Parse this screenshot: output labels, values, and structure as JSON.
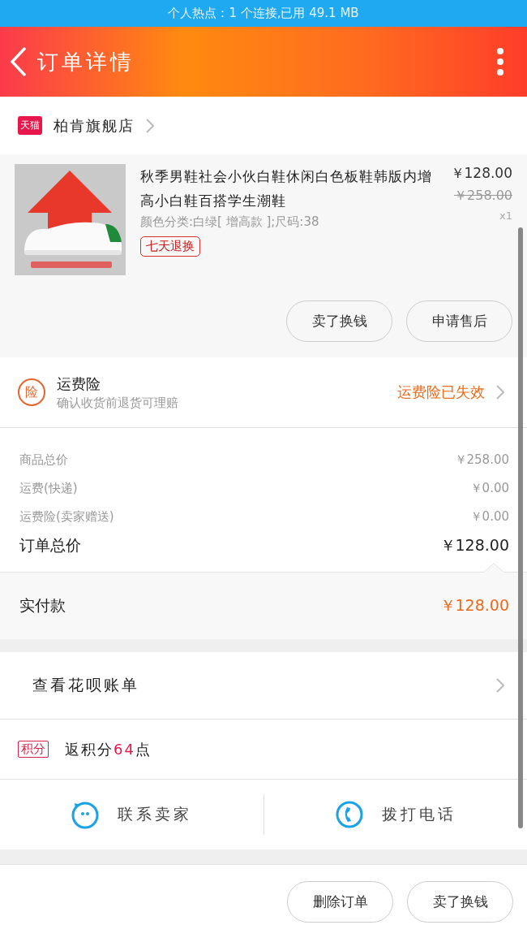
{
  "status_bar": {
    "text": "个人热点：1 个连接,已用 49.1 MB"
  },
  "header": {
    "title": "订单详情"
  },
  "store": {
    "badge": "天猫",
    "name": "柏肯旗舰店"
  },
  "product": {
    "kind": "picture",
    "title": "秋季男鞋社会小伙白鞋休闲白色板鞋韩版内增高小白鞋百搭学生潮鞋",
    "price": "￥128.00",
    "original_price": "￥258.00",
    "sku": "颜色分类:白绿[ 增高款 ];尺码:38",
    "quantity": "x1",
    "tag": "七天退换",
    "actions": [
      "卖了换钱",
      "申请售后"
    ]
  },
  "insurance": {
    "icon": "险",
    "title": "运费险",
    "subtitle": "确认收货前退货可理赔",
    "status": "运费险已失效"
  },
  "summary": [
    {
      "label": "商品总价",
      "value": "￥258.00",
      "kind": "minor"
    },
    {
      "label": "运费(快递)",
      "value": "￥0.00",
      "kind": "minor"
    },
    {
      "label": "运费险(卖家赠送)",
      "value": "￥0.00",
      "kind": "minor"
    },
    {
      "label": "订单总价",
      "value": "￥128.00",
      "kind": "total"
    }
  ],
  "paid": {
    "label": "实付款",
    "value": "￥128.00"
  },
  "huabei": {
    "label": "查看花呗账单"
  },
  "points": {
    "badge": "积分",
    "prefix": "返积分",
    "amount": "64",
    "suffix": "点"
  },
  "contact": [
    {
      "kind": "chat",
      "label": "联系卖家"
    },
    {
      "kind": "phone",
      "label": "拨打电话"
    }
  ],
  "bottom_actions": [
    "删除订单",
    "卖了换钱"
  ]
}
